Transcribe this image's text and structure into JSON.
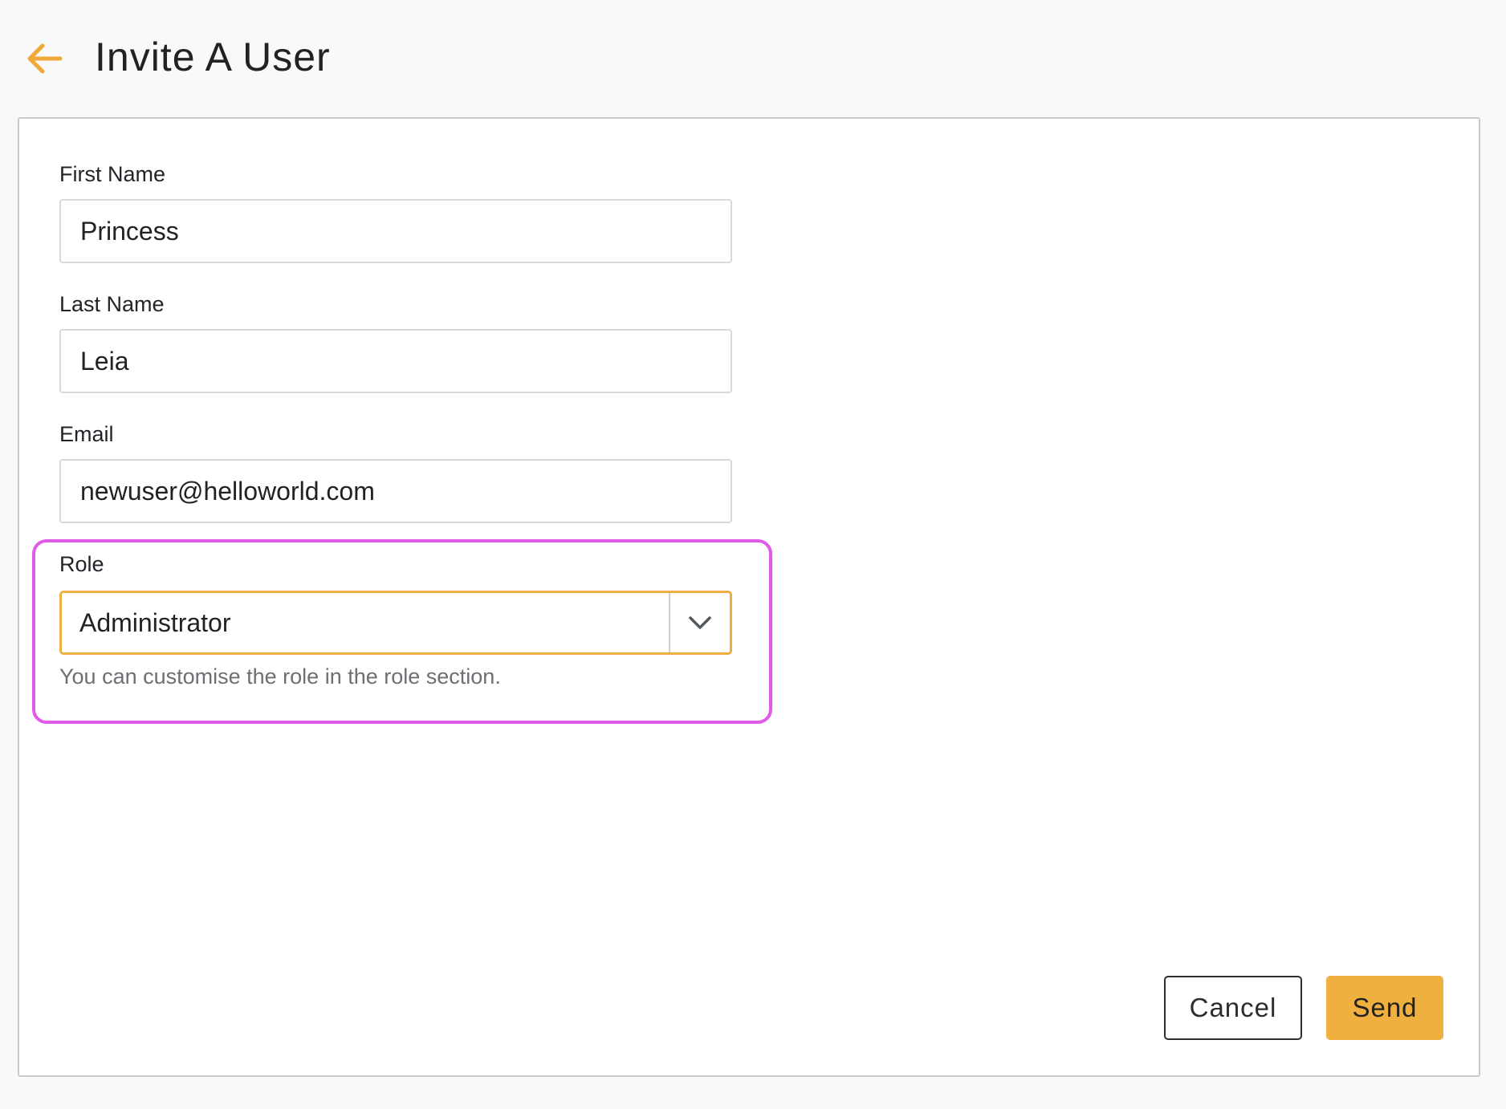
{
  "header": {
    "title": "Invite A User",
    "back_icon": "arrow-left-icon",
    "accent_color": "#f0a83a"
  },
  "form": {
    "first_name": {
      "label": "First Name",
      "value": "Princess"
    },
    "last_name": {
      "label": "Last Name",
      "value": "Leia"
    },
    "email": {
      "label": "Email",
      "value": "newuser@helloworld.com"
    },
    "role": {
      "label": "Role",
      "selected": "Administrator",
      "caret_icon": "chevron-down-icon",
      "help_text": "You can customise the role in the role section.",
      "highlight_color": "#e05be8"
    }
  },
  "actions": {
    "cancel_label": "Cancel",
    "send_label": "Send",
    "send_color": "#f0b03f"
  }
}
